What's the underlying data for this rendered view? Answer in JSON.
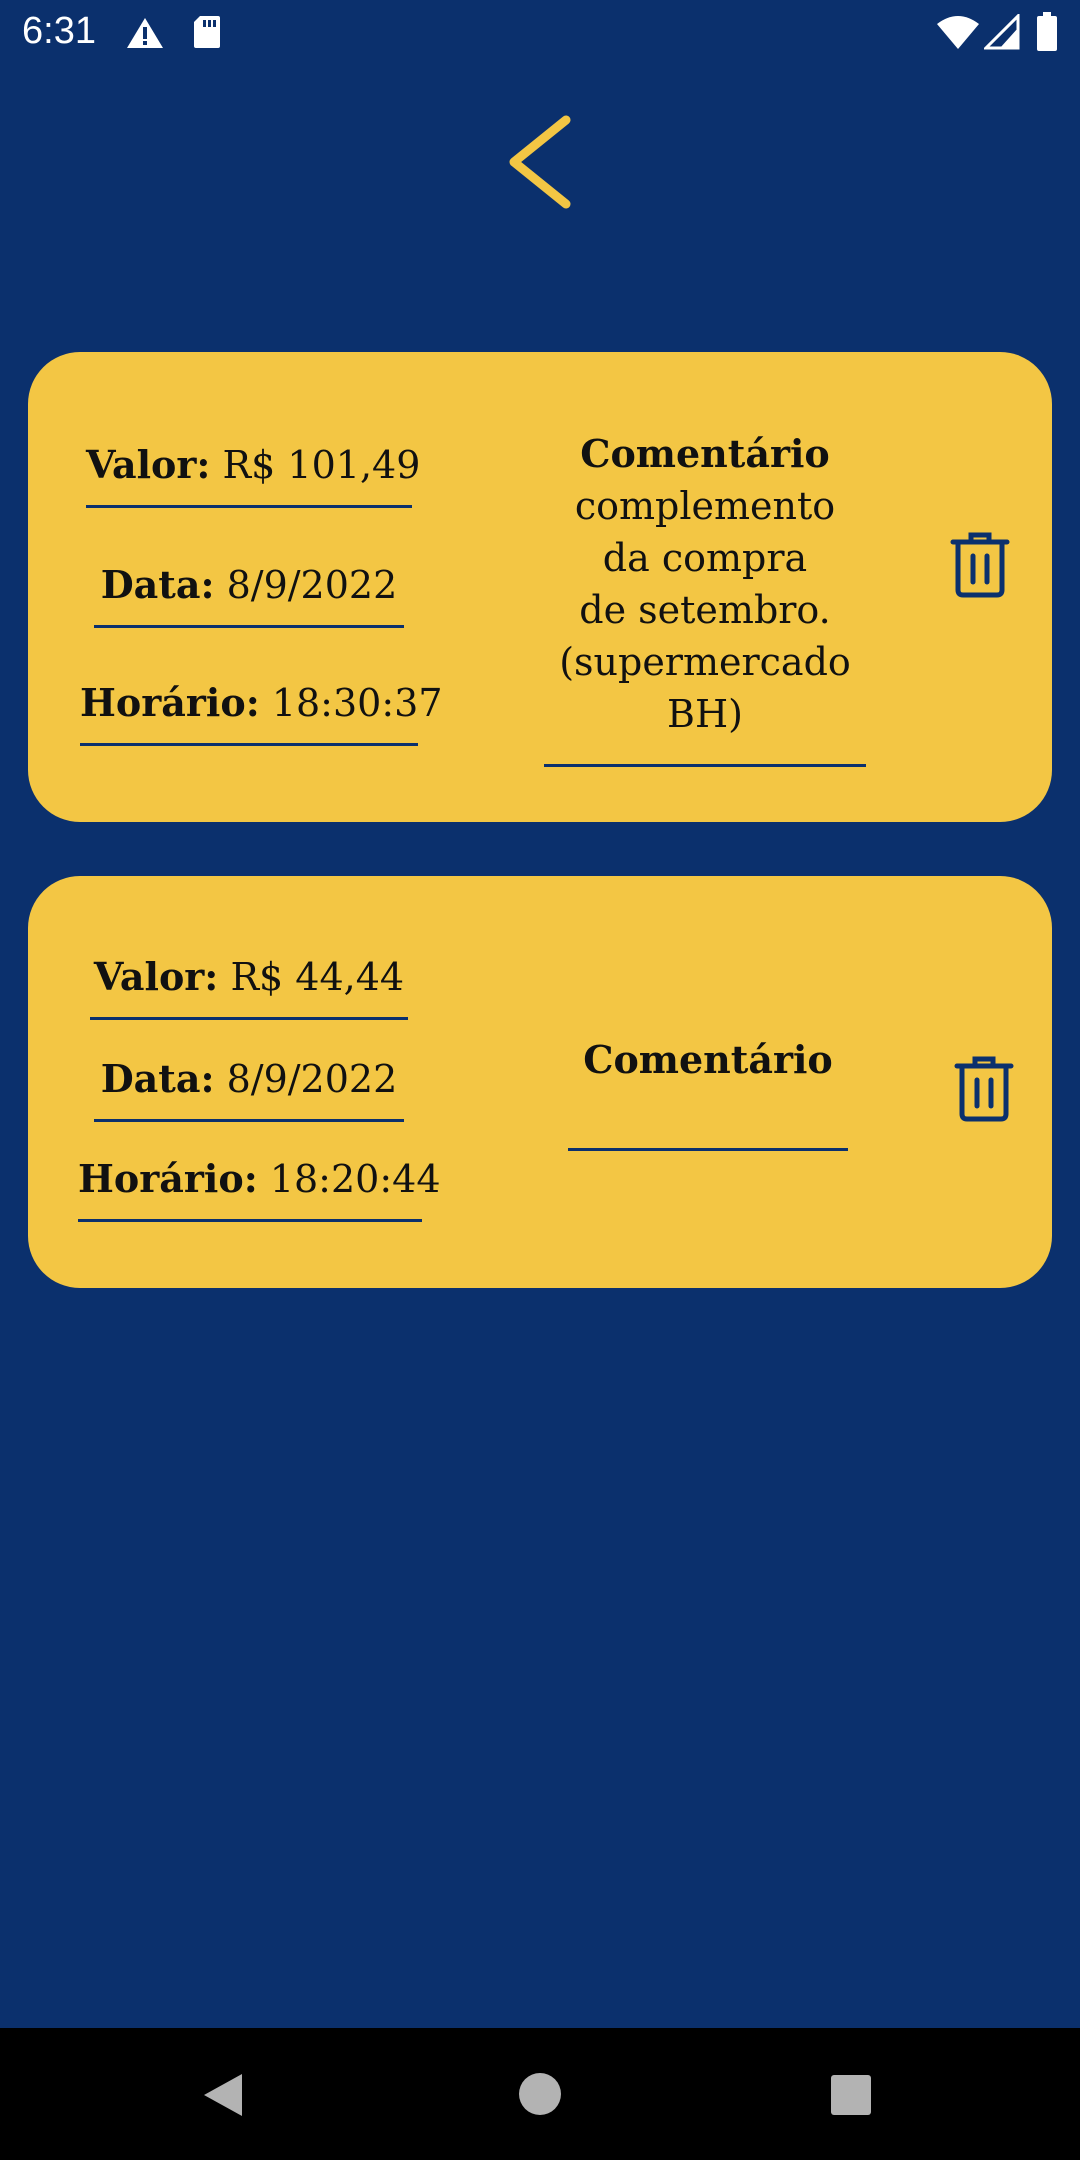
{
  "status_bar": {
    "time": "6:31",
    "icons_left": [
      "warning-icon",
      "sd-card-icon"
    ],
    "icons_right": [
      "wifi-icon",
      "signal-icon",
      "battery-icon"
    ]
  },
  "header": {
    "back_icon": "chevron-left-icon",
    "accent_color": "#f3c644"
  },
  "colors": {
    "background": "#0b306d",
    "card": "#f3c644",
    "text": "#111111"
  },
  "records": [
    {
      "valor_label": "Valor:",
      "valor": "R$ 101,49",
      "data_label": "Data:",
      "data": "8/9/2022",
      "horario_label": "Horário:",
      "horario": "18:30:37",
      "comment_label": "Comentário",
      "comment_lines": [
        "complemento",
        "da compra",
        "de setembro.",
        "(supermercado",
        "BH)"
      ]
    },
    {
      "valor_label": "Valor:",
      "valor": "R$ 44,44",
      "data_label": "Data:",
      "data": "8/9/2022",
      "horario_label": "Horário:",
      "horario": "18:20:44",
      "comment_label": "Comentário",
      "comment_lines": []
    }
  ],
  "nav_bar": {
    "icons": [
      "back-triangle-icon",
      "home-circle-icon",
      "recents-square-icon"
    ]
  }
}
